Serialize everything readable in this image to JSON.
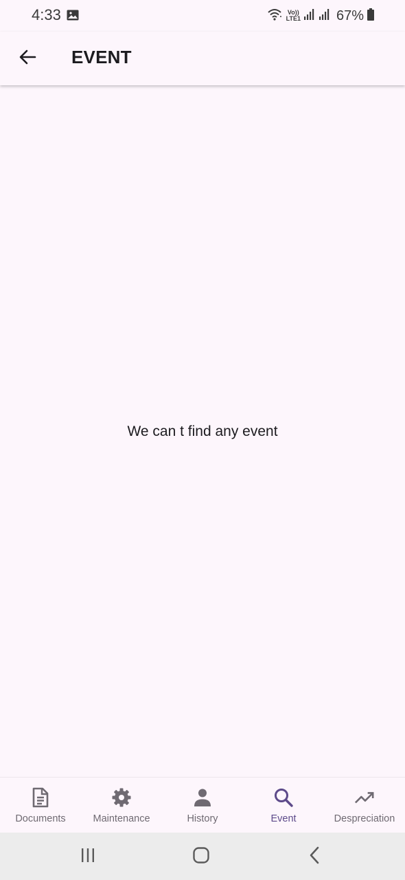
{
  "status_bar": {
    "time": "4:33",
    "volte_top": "Vo))",
    "volte_bottom": "LTE1",
    "battery": "67%",
    "icons": [
      "image-icon",
      "wifi-icon",
      "signal-icon",
      "signal-icon",
      "battery-icon"
    ]
  },
  "app_bar": {
    "title": "EVENT",
    "back_icon": "arrow-back-icon"
  },
  "content": {
    "empty_message": "We can t find any event"
  },
  "bottom_nav": {
    "active_index": 3,
    "items": [
      {
        "label": "Documents",
        "icon": "document-icon"
      },
      {
        "label": "Maintenance",
        "icon": "gear-icon"
      },
      {
        "label": "History",
        "icon": "person-icon"
      },
      {
        "label": "Event",
        "icon": "search-icon"
      },
      {
        "label": "Despreciation",
        "icon": "trending-up-icon"
      }
    ]
  },
  "system_nav": {
    "items": [
      "recents-icon",
      "home-icon",
      "back-icon"
    ]
  },
  "colors": {
    "background": "#fdf6fc",
    "nav_inactive": "#6f6a72",
    "nav_active": "#5d4a8a",
    "text": "#1c1b1f"
  }
}
